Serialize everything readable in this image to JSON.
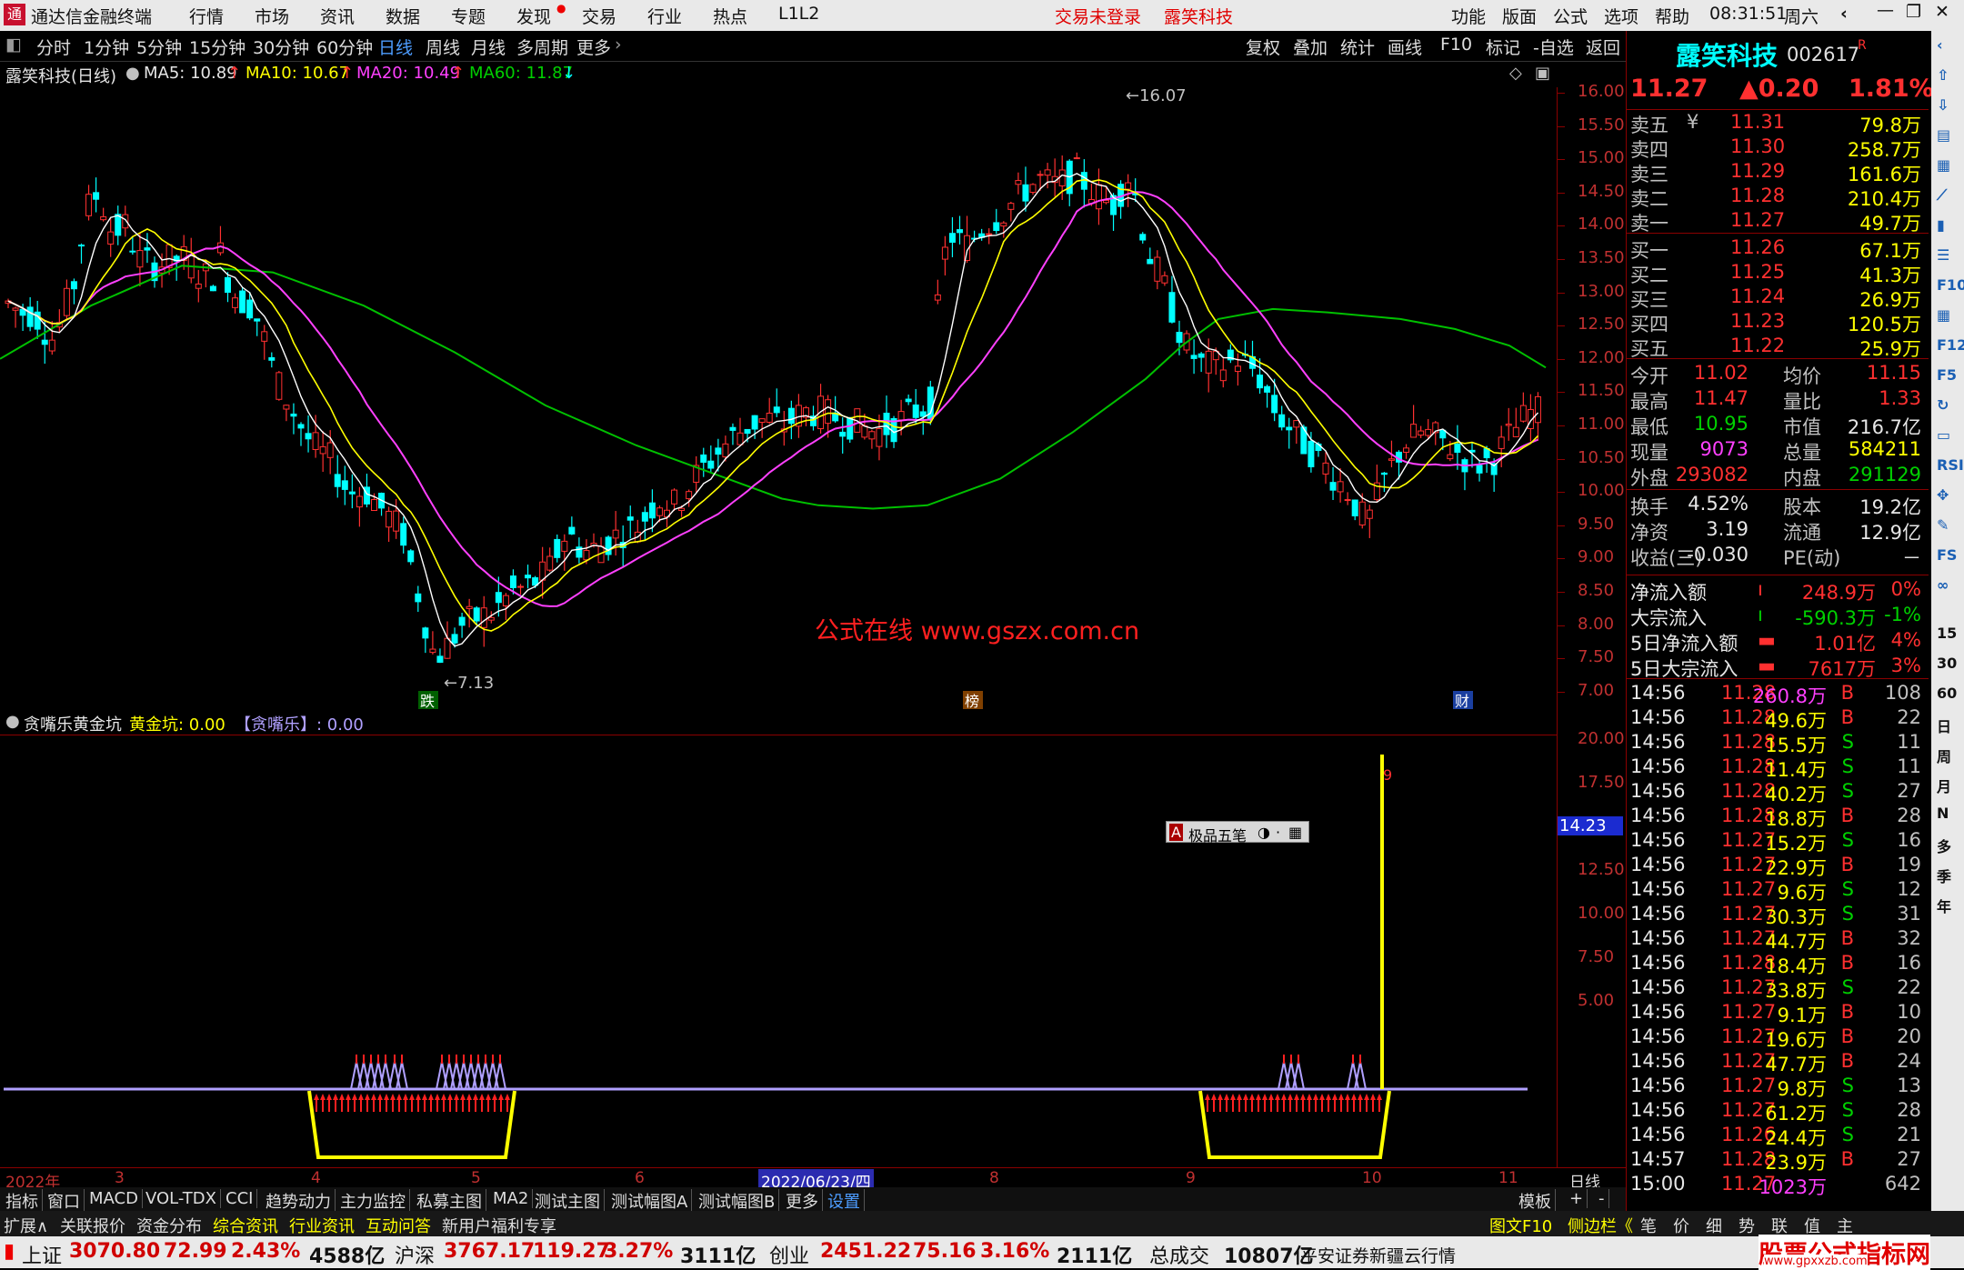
{
  "titlebar": {
    "app": "通达信金融终端",
    "menus": [
      "行情",
      "市场",
      "资讯",
      "数据",
      "专题",
      "发现",
      "交易",
      "行业",
      "热点",
      "L1L2"
    ],
    "login_status": "交易未登录",
    "stock_name": "露笑科技",
    "right_menus": [
      "功能",
      "版面",
      "公式",
      "选项",
      "帮助"
    ],
    "time": "08:31:51",
    "weekday": "周六"
  },
  "toolbar": {
    "periods": [
      "分时",
      "1分钟",
      "5分钟",
      "15分钟",
      "30分钟",
      "60分钟",
      "日线",
      "周线",
      "月线",
      "多周期",
      "更多"
    ],
    "active_period": "日线",
    "right_buttons": [
      "复权",
      "叠加",
      "统计",
      "画线",
      "F10",
      "标记",
      "-自选",
      "返回"
    ]
  },
  "chart_info": {
    "name": "露笑科技(日线)",
    "ma5": "MA5: 10.89",
    "ma10": "MA10: 10.67",
    "ma20": "MA20: 10.49",
    "ma60": "MA60: 11.87"
  },
  "main_y_ticks": [
    "16.00",
    "15.50",
    "15.00",
    "14.50",
    "14.00",
    "13.50",
    "13.00",
    "12.50",
    "12.00",
    "11.50",
    "11.00",
    "10.50",
    "10.00",
    "9.50",
    "9.00",
    "8.50",
    "8.00",
    "7.50",
    "7.00"
  ],
  "annotations": {
    "high": "16.07",
    "low": "7.13",
    "watermark": "公式在线  www.gszx.com.cn",
    "marker_1": "跌",
    "marker_2": "榜",
    "marker_3": "财"
  },
  "sub_info": {
    "name": "贪嘴乐黄金坑",
    "golden_pit": "黄金坑: 0.00",
    "label": "【贪嘴乐】: 0.00"
  },
  "sub_y_ticks": [
    "20.00",
    "17.50",
    "12.50",
    "10.00",
    "7.50",
    "5.00"
  ],
  "sub_y_highlight": "14.23",
  "tooltip": "极品五笔",
  "xaxis": {
    "labels": [
      "2022年",
      "3",
      "4",
      "5",
      "6",
      "2022/06/23/四",
      "8",
      "9",
      "10",
      "11"
    ],
    "period": "日线"
  },
  "bottom_tabs": [
    "指标",
    "窗口",
    "MACD",
    "VOL-TDX",
    "CCI",
    "趋势动力",
    "主力监控",
    "私募主图",
    "MA2",
    "测试主图",
    "测试幅图A",
    "测试幅图B",
    "更多",
    "设置"
  ],
  "bottom_right": [
    "模板",
    "+",
    "-"
  ],
  "tabs2": [
    "扩展∧",
    "关联报价",
    "资金分布",
    "综合资讯",
    "行业资讯",
    "互动问答",
    "新用户福利专享"
  ],
  "tabs2_right": [
    "图文F10",
    "侧边栏《",
    "笔",
    "价",
    "细",
    "势",
    "联",
    "值",
    "主"
  ],
  "statusbar": {
    "sh_label": "上证",
    "sh_val": "3070.80",
    "sh_chg": "72.99",
    "sh_pct": "2.43%",
    "sh_amt": "4588亿",
    "sz_label": "沪深",
    "sz_val": "3767.17",
    "sz_chg": "119.27",
    "sz_pct": "3.27%",
    "sz_amt": "3111亿",
    "cy_label": "创业",
    "cy_val": "2451.22",
    "cy_chg": "75.16",
    "cy_pct": "3.16%",
    "cy_amt": "2111亿",
    "total_label": "总成交",
    "total_amt": "10807亿",
    "source": "平安证券新疆云行情",
    "brand": "股票公式指标网",
    "brand_url": "www.gpxxzb.com"
  },
  "quote": {
    "name": "露笑科技",
    "code": "002617",
    "flag": "R",
    "price": "11.27",
    "change": "▲0.20",
    "pct": "1.81%",
    "asks": [
      {
        "label": "卖五",
        "sym": "¥",
        "price": "11.31",
        "vol": "79.8万"
      },
      {
        "label": "卖四",
        "price": "11.30",
        "vol": "258.7万"
      },
      {
        "label": "卖三",
        "price": "11.29",
        "vol": "161.6万"
      },
      {
        "label": "卖二",
        "price": "11.28",
        "vol": "210.4万"
      },
      {
        "label": "卖一",
        "price": "11.27",
        "vol": "49.7万"
      }
    ],
    "bids": [
      {
        "label": "买一",
        "price": "11.26",
        "vol": "67.1万"
      },
      {
        "label": "买二",
        "price": "11.25",
        "vol": "41.3万"
      },
      {
        "label": "买三",
        "price": "11.24",
        "vol": "26.9万"
      },
      {
        "label": "买四",
        "price": "11.23",
        "vol": "120.5万"
      },
      {
        "label": "买五",
        "price": "11.22",
        "vol": "25.9万"
      }
    ],
    "stats": [
      [
        "今开",
        "11.02",
        "均价",
        "11.15"
      ],
      [
        "最高",
        "11.47",
        "量比",
        "1.33"
      ],
      [
        "最低",
        "10.95",
        "市值",
        "216.7亿"
      ],
      [
        "现量",
        "9073",
        "总量",
        "584211"
      ],
      [
        "外盘",
        "293082",
        "内盘",
        "291129"
      ]
    ],
    "stats2": [
      [
        "换手",
        "4.52%",
        "股本",
        "19.2亿"
      ],
      [
        "净资",
        "3.19",
        "流通",
        "12.9亿"
      ],
      [
        "收益(三)",
        "-0.030",
        "PE(动)",
        "－"
      ]
    ],
    "flows": [
      [
        "净流入额",
        "248.9万",
        "0%"
      ],
      [
        "大宗流入",
        "-590.3万",
        "-1%"
      ],
      [
        "5日净流入额",
        "1.01亿",
        "4%"
      ],
      [
        "5日大宗流入",
        "7617万",
        "3%"
      ]
    ],
    "ticks": [
      [
        "14:56",
        "11.28",
        "260.8万",
        "B",
        "108"
      ],
      [
        "14:56",
        "11.28",
        "49.6万",
        "B",
        "22"
      ],
      [
        "14:56",
        "11.28",
        "15.5万",
        "S",
        "11"
      ],
      [
        "14:56",
        "11.28",
        "11.4万",
        "S",
        "11"
      ],
      [
        "14:56",
        "11.28",
        "40.2万",
        "S",
        "27"
      ],
      [
        "14:56",
        "11.28",
        "18.8万",
        "B",
        "28"
      ],
      [
        "14:56",
        "11.27",
        "15.2万",
        "S",
        "16"
      ],
      [
        "14:56",
        "11.27",
        "22.9万",
        "B",
        "19"
      ],
      [
        "14:56",
        "11.27",
        "9.6万",
        "S",
        "12"
      ],
      [
        "14:56",
        "11.27",
        "30.3万",
        "S",
        "31"
      ],
      [
        "14:56",
        "11.27",
        "44.7万",
        "B",
        "32"
      ],
      [
        "14:56",
        "11.28",
        "18.4万",
        "B",
        "16"
      ],
      [
        "14:56",
        "11.27",
        "33.8万",
        "S",
        "22"
      ],
      [
        "14:56",
        "11.27",
        "9.1万",
        "B",
        "10"
      ],
      [
        "14:56",
        "11.27",
        "19.6万",
        "B",
        "20"
      ],
      [
        "14:56",
        "11.27",
        "47.7万",
        "B",
        "24"
      ],
      [
        "14:56",
        "11.27",
        "9.8万",
        "S",
        "13"
      ],
      [
        "14:56",
        "11.27",
        "61.2万",
        "S",
        "28"
      ],
      [
        "14:56",
        "11.26",
        "24.4万",
        "S",
        "21"
      ],
      [
        "14:57",
        "11.28",
        "23.9万",
        "B",
        "27"
      ],
      [
        "15:00",
        "11.27",
        "1023万",
        "",
        "642"
      ]
    ]
  },
  "sidebar_icons": [
    "collapse-icon",
    "up-icon",
    "down-icon",
    "chart-icon",
    "table-icon",
    "trend-icon",
    "kline-icon",
    "list-icon",
    "f10-icon",
    "grid-icon",
    "f12-icon",
    "f5-icon",
    "refresh-icon",
    "tv-icon",
    "rsi-icon",
    "move-icon",
    "pen-icon",
    "fs-icon",
    "link-icon",
    "15",
    "30",
    "60",
    "日",
    "周",
    "月",
    "N",
    "多",
    "季",
    "年"
  ],
  "colors": {
    "up": "#ff3030",
    "down": "#00ffff",
    "ma5": "#ffffff",
    "ma10": "#ffff00",
    "ma20": "#ff40ff",
    "ma60": "#00c000",
    "axis": "#8b0000",
    "indicator_line": "#b0a0ff"
  }
}
